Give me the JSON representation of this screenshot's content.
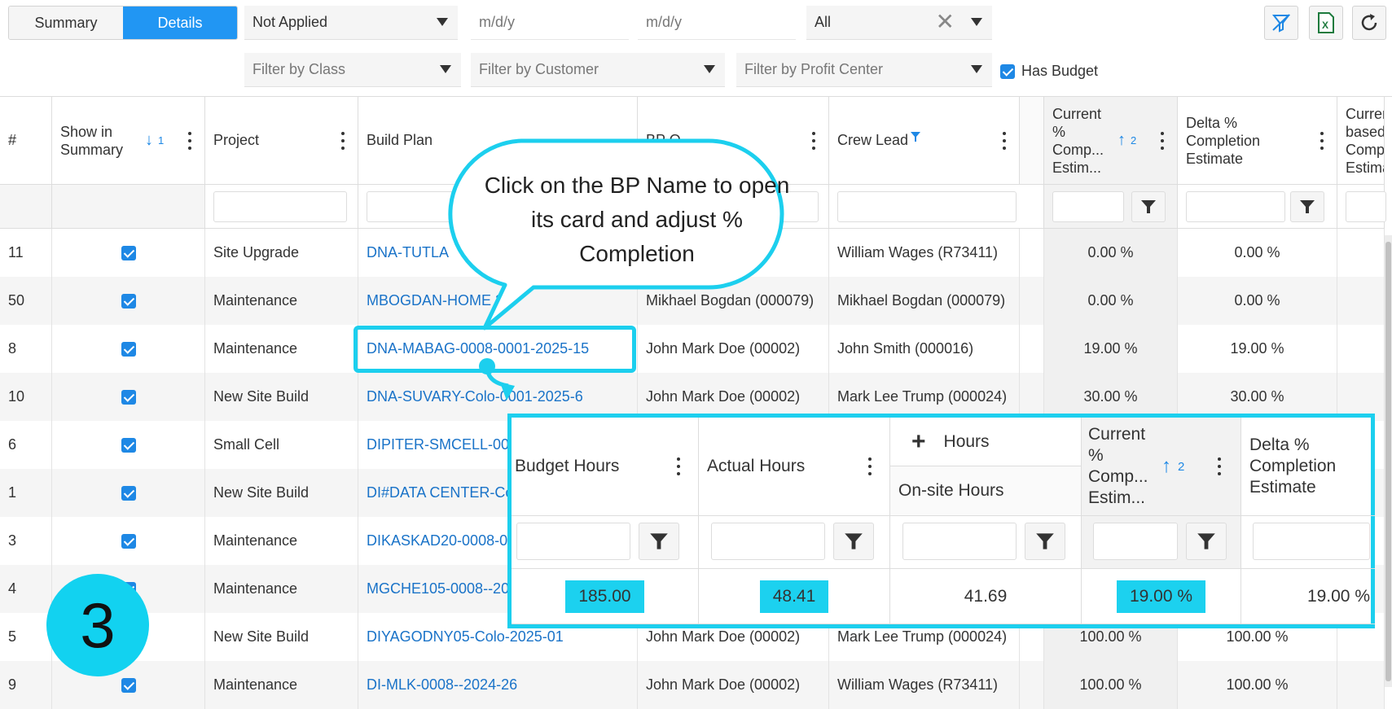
{
  "toolbar": {
    "view_tabs": [
      "Summary",
      "Details"
    ],
    "status_filter": "Not Applied",
    "date_from_placeholder": "m/d/y",
    "date_to_placeholder": "m/d/y",
    "scope_filter": "All",
    "class_filter_placeholder": "Filter by Class",
    "customer_filter_placeholder": "Filter by Customer",
    "profit_center_filter_placeholder": "Filter by Profit Center",
    "has_budget_label": "Has Budget",
    "has_budget_checked": true,
    "icons": [
      "clear-filter-icon",
      "excel-export-icon",
      "refresh-icon"
    ]
  },
  "grid": {
    "headers": {
      "num": "#",
      "show_in_summary": "Show in Summary",
      "show_sort_index": "1",
      "project": "Project",
      "build_plan": "Build Plan",
      "bp_owner": "BP O",
      "crew_lead": "Crew Lead",
      "current_pct": "Current % Comp... Estim...",
      "current_sort_index": "2",
      "delta_pct": "Delta % Completion Estimate",
      "current_based": "Curren based Comp Estima"
    },
    "rows": [
      {
        "num": "11",
        "project": "Site Upgrade",
        "build_plan": "DNA-TUTLA",
        "owner": "",
        "crew_lead": "William Wages (R73411)",
        "current": "0.00 %",
        "delta": "0.00 %"
      },
      {
        "num": "50",
        "project": "Maintenance",
        "build_plan": "MBOGDAN-HOME 20",
        "owner": "Mikhael Bogdan (000079)",
        "crew_lead": "Mikhael Bogdan (000079)",
        "current": "0.00 %",
        "delta": "0.00 %"
      },
      {
        "num": "8",
        "project": "Maintenance",
        "build_plan": "DNA-MABAG-0008-0001-2025-15",
        "owner": "John Mark Doe (00002)",
        "crew_lead": "John Smith (000016)",
        "current": "19.00 %",
        "delta": "19.00 %"
      },
      {
        "num": "10",
        "project": "New Site Build",
        "build_plan": "DNA-SUVARY-Colo-0001-2025-6",
        "owner": "John Mark Doe (00002)",
        "crew_lead": "Mark Lee Trump (000024)",
        "current": "30.00 %",
        "delta": "30.00 %"
      },
      {
        "num": "6",
        "project": "Small Cell",
        "build_plan": "DIPITER-SMCELL-000",
        "owner": "",
        "crew_lead": "",
        "current": "",
        "delta": ""
      },
      {
        "num": "1",
        "project": "New Site Build",
        "build_plan": "DI#DATA CENTER-Co",
        "owner": "",
        "crew_lead": "",
        "current": "",
        "delta": ""
      },
      {
        "num": "3",
        "project": "Maintenance",
        "build_plan": "DIKASKAD20-0008-00",
        "owner": "",
        "crew_lead": "",
        "current": "",
        "delta": ""
      },
      {
        "num": "4",
        "project": "Maintenance",
        "build_plan": "MGCHE105-0008--20",
        "owner": "",
        "crew_lead": "",
        "current": "",
        "delta": ""
      },
      {
        "num": "5",
        "project": "New Site Build",
        "build_plan": "DIYAGODNY05-Colo-2025-01",
        "owner": "John Mark Doe (00002)",
        "crew_lead": "Mark Lee Trump (000024)",
        "current": "100.00 %",
        "delta": "100.00 %"
      },
      {
        "num": "9",
        "project": "Maintenance",
        "build_plan": "DI-MLK-0008--2024-26",
        "owner": "John Mark Doe (00002)",
        "crew_lead": "William Wages (R73411)",
        "current": "100.00 %",
        "delta": "100.00 %"
      }
    ]
  },
  "callout": {
    "text": "Click on the BP Name to open its card and adjust % Completion"
  },
  "step_badge": "3",
  "zoom_panel": {
    "headers": {
      "budget_hours": "Budget Hours",
      "actual_hours": "Actual Hours",
      "hours_group": "Hours",
      "onsite_hours": "On-site Hours",
      "current_pct": "Current % Comp... Estim...",
      "current_sort_index": "2",
      "delta_pct": "Delta % Completion Estimate"
    },
    "values": {
      "budget_hours": "185.00",
      "actual_hours": "48.41",
      "onsite_hours": "41.69",
      "current_pct": "19.00 %",
      "delta_pct": "19.00 %"
    }
  },
  "colors": {
    "accent": "#2196f3",
    "link": "#1a73c8",
    "highlight": "#1cd1ef"
  }
}
